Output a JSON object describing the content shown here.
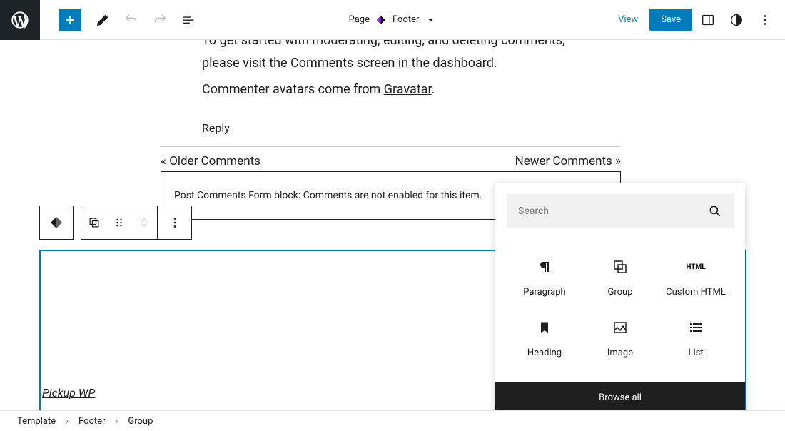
{
  "topbar": {
    "page_label": "Page",
    "template_label": "Footer",
    "view_label": "View",
    "save_label": "Save"
  },
  "content": {
    "line1": "To get started with moderating, editing, and deleting comments, please visit the Comments screen in the dashboard.",
    "line2_prefix": "Commenter avatars come from ",
    "line2_link": "Gravatar",
    "line2_suffix": ".",
    "reply": "Reply"
  },
  "nav": {
    "older": "« Older Comments",
    "newer": "Newer Comments »"
  },
  "comments_form": "Post Comments Form block: Comments are not enabled for this item.",
  "site_title": "Pickup WP",
  "inserter": {
    "search_placeholder": "Search",
    "blocks": [
      {
        "label": "Paragraph",
        "icon": "paragraph"
      },
      {
        "label": "Group",
        "icon": "group"
      },
      {
        "label": "Custom HTML",
        "icon": "html"
      },
      {
        "label": "Heading",
        "icon": "heading"
      },
      {
        "label": "Image",
        "icon": "image"
      },
      {
        "label": "List",
        "icon": "list"
      }
    ],
    "browse_all": "Browse all"
  },
  "breadcrumb": {
    "items": [
      "Template",
      "Footer",
      "Group"
    ]
  }
}
